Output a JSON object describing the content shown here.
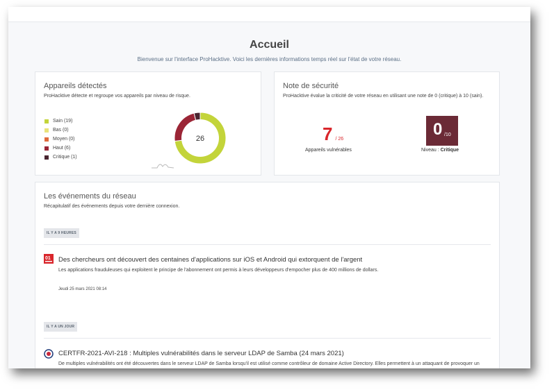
{
  "page": {
    "title": "Accueil",
    "subtitle": "Bienvenue sur l'interface ProHacktive. Voici les dernières informations temps réel sur l'état de votre réseau."
  },
  "devices_card": {
    "title": "Appareils détectés",
    "description": "ProHacktive détecte et regroupe vos appareils par niveau de risque.",
    "legend": [
      {
        "label": "Sain (19)",
        "color": "#c3d43a",
        "value": 19
      },
      {
        "label": "Bas (0)",
        "color": "#e9e27a",
        "value": 0
      },
      {
        "label": "Moyen (0)",
        "color": "#e06a3c",
        "value": 0
      },
      {
        "label": "Haut (6)",
        "color": "#9b2536",
        "value": 6
      },
      {
        "label": "Critique (1)",
        "color": "#4a2530",
        "value": 1
      }
    ],
    "total": "26"
  },
  "security_card": {
    "title": "Note de sécurité",
    "description": "ProHacktive évalue la criticité de votre réseau en utilisant une note de 0 (critique) à 10 (sain).",
    "vulnerable_value": "7",
    "vulnerable_total": "/ 26",
    "vulnerable_label": "Appareils vulnérables",
    "score_value": "0",
    "score_total": "/10",
    "level_prefix": "Niveau : ",
    "level_value": "Critique"
  },
  "events_card": {
    "title": "Les événements du réseau",
    "description": "Récapitulatif des événements depuis votre dernière connexion.",
    "events": [
      {
        "time_tag": "IL Y A 9 HEURES",
        "source_icon": "01net-logo",
        "title": "Des chercheurs ont découvert des centaines d'applications sur iOS et Android qui extorquent de l'argent",
        "description": "Les applications frauduleuses qui exploitent le principe de l'abonnement ont permis à leurs développeurs d'empocher plus de 400 millions de dollars.",
        "date": "Jeudi 25 mars 2021 08:14"
      },
      {
        "time_tag": "IL Y A UN JOUR",
        "source_icon": "cert-fr-logo",
        "title": "CERTFR-2021-AVI-218 : Multiples vulnérabilités dans le serveur LDAP de Samba (24 mars 2021)",
        "description": "De multiples vulnérabilités ont été découvertes dans le serveur LDAP de Samba lorsqu'il est utilisé comme contrôleur de domaine Active Directory. Elles permettent à un attaquant de provoquer un déni de service à distance."
      }
    ]
  },
  "colors": {
    "vulnerable_red": "#d9262b",
    "score_badge": "#6b2a36"
  }
}
